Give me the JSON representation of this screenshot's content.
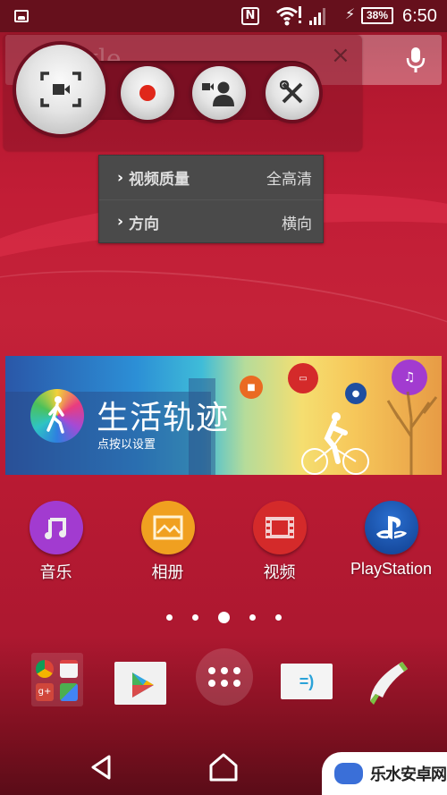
{
  "status_bar": {
    "notification_icon": "image-icon",
    "nfc_label": "N",
    "battery_percent": "38%",
    "time": "6:50"
  },
  "search_widget": {
    "logo_text": "Google",
    "clear_icon": "×",
    "mic_icon": "mic-icon"
  },
  "recorder": {
    "buttons": [
      {
        "name": "screen-record",
        "icon": "screen-video-icon"
      },
      {
        "name": "record",
        "icon": "record-dot-icon"
      },
      {
        "name": "front-camera",
        "icon": "camera-person-icon"
      },
      {
        "name": "settings",
        "icon": "tools-icon"
      }
    ],
    "accent": "#e0271a"
  },
  "settings_menu": {
    "items": [
      {
        "chevron": "›",
        "label": "视频质量",
        "value": "全高清"
      },
      {
        "chevron": "›",
        "label": "方向",
        "value": "横向"
      }
    ]
  },
  "lifelog_widget": {
    "title": "生活轨迹",
    "subtitle": "点按以设置"
  },
  "apps": [
    {
      "label": "音乐",
      "color": "#a23bd0"
    },
    {
      "label": "相册",
      "color": "#f0a020"
    },
    {
      "label": "视频",
      "color": "#d42a2a"
    },
    {
      "label": "PlayStation",
      "color": "#1450a8"
    }
  ],
  "page_indicator": {
    "total": 5,
    "current": 3
  },
  "dock": {
    "message_glyph": "=)",
    "items": [
      "google-folder",
      "play-store",
      "app-drawer",
      "messaging",
      "phone"
    ]
  },
  "watermark": {
    "text": "乐水安卓网"
  }
}
